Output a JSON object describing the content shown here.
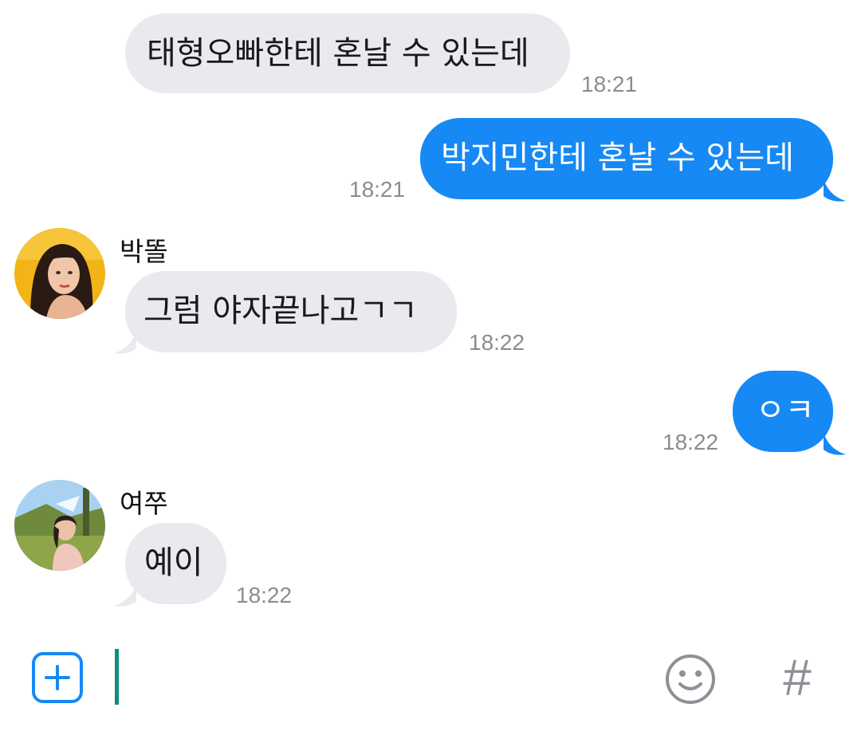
{
  "messages": [
    {
      "direction": "incoming",
      "text": "태형오빠한테 혼날 수 있는데",
      "time": "18:21"
    },
    {
      "direction": "outgoing",
      "text": "박지민한테 혼날 수 있는데",
      "time": "18:21"
    },
    {
      "direction": "incoming",
      "sender": "박똘",
      "avatar_icon": "profile-photo-yellow",
      "text": "그럼 야자끝나고ㄱㄱ",
      "time": "18:22"
    },
    {
      "direction": "outgoing",
      "text": "ㅇㅋ",
      "time": "18:22"
    },
    {
      "direction": "incoming",
      "sender": "여쭈",
      "avatar_icon": "profile-photo-outdoor",
      "text": "예이",
      "time": "18:22"
    }
  ],
  "input_bar": {
    "plus_icon": "plus-square-icon",
    "message_value": "",
    "emoji_icon": "smiley-icon",
    "hashtag_label": "#"
  },
  "colors": {
    "outgoing_bubble": "#1689f5",
    "incoming_bubble": "#e9e9ee",
    "timestamp": "#8c8c92",
    "caret": "#0c8f7a"
  }
}
